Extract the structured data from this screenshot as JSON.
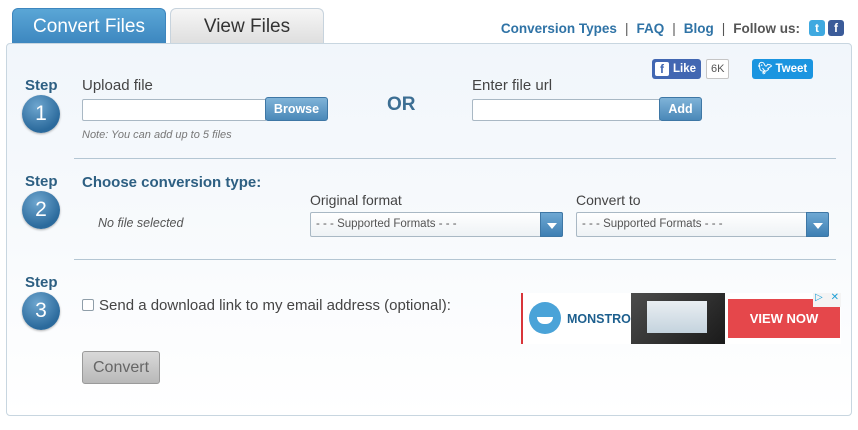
{
  "tabs": [
    {
      "label": "Convert Files",
      "active": true
    },
    {
      "label": "View Files",
      "active": false
    }
  ],
  "toplinks": {
    "conversion_types": "Conversion Types",
    "faq": "FAQ",
    "blog": "Blog",
    "separator": "|",
    "follow_us": "Follow us:"
  },
  "social": {
    "like_label": "Like",
    "like_count": "6K",
    "tweet_label": "Tweet"
  },
  "step_word": "Step",
  "step1": {
    "number": "1",
    "upload_label": "Upload file",
    "browse_label": "Browse",
    "note": "Note: You can add up to 5 files",
    "or_label": "OR",
    "url_label": "Enter file url",
    "add_label": "Add",
    "file_value": "",
    "url_value": ""
  },
  "step2": {
    "number": "2",
    "heading": "Choose conversion type:",
    "no_file": "No file selected",
    "original_label": "Original format",
    "convert_to_label": "Convert to",
    "original_selected": "- - - Supported Formats - - -",
    "convert_to_selected": "- - - Supported Formats - - -"
  },
  "step3": {
    "number": "3",
    "email_label": "Send a download link to my email address (optional):",
    "email_checked": false,
    "convert_label": "Convert"
  },
  "ad": {
    "brand": "MONSTROID",
    "cta": "VIEW NOW"
  },
  "colors": {
    "accent": "#3c86bf",
    "step_text": "#2d5f82",
    "link": "#2f73a6",
    "ad_red": "#e5474b"
  }
}
